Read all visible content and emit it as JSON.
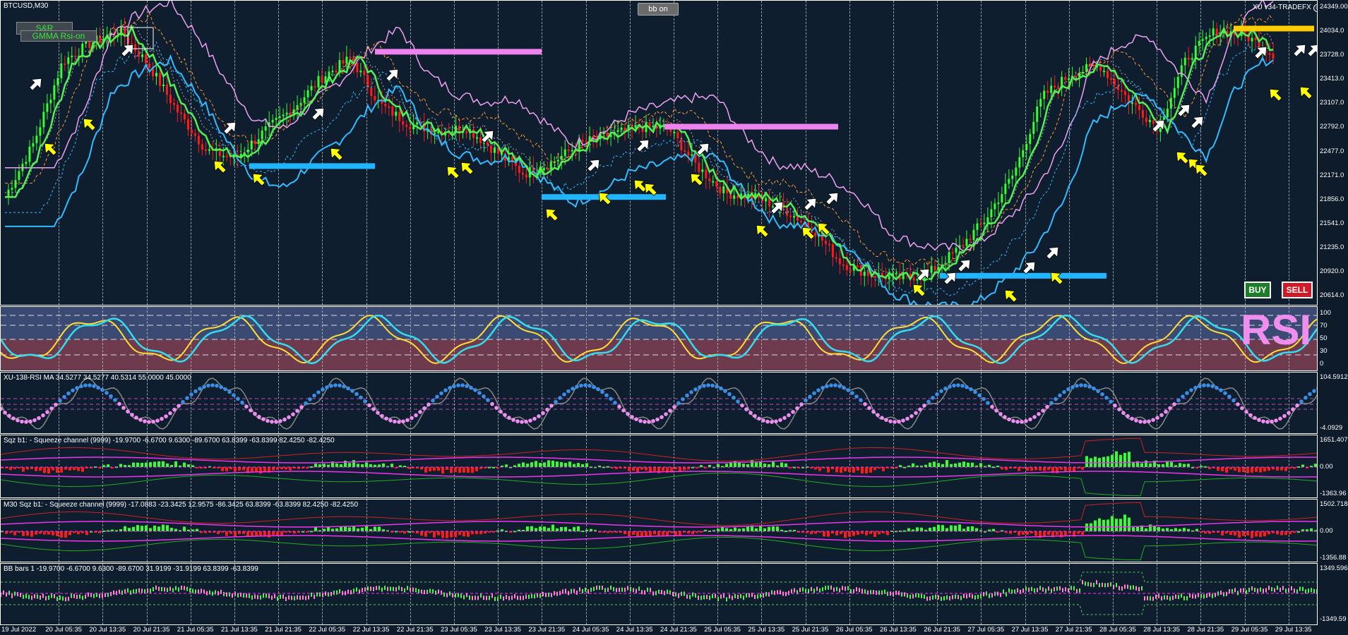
{
  "window": {
    "symbol": "BTCUSD,M30",
    "expert_label": "XU v34-TRADEFX",
    "toggle_bb_label": "bb on"
  },
  "overlay_buttons": {
    "sr_label": "S&R",
    "gmma_label": "GMMA Rsi-on",
    "buy_label": "BUY",
    "sell_label": "SELL"
  },
  "colors": {
    "background": "#0e1e2e",
    "grid": "#c8c8c8",
    "bull": "#33ff33",
    "bear": "#ff1a1a",
    "band_outer": "#f0a0f0",
    "band_inner": "#33bbff",
    "arrow_buy": "#ffff00",
    "arrow_sell": "#ffffff",
    "level_pink": "#ee82ee",
    "level_blue": "#1fb6ff",
    "level_gold": "#ffcc00"
  },
  "price_axis": {
    "ticks": [
      "24349.00",
      "24034.0",
      "23728.0",
      "23413.0",
      "23107.0",
      "22792.0",
      "22477.0",
      "22171.0",
      "21856.0",
      "21541.0",
      "21235.0",
      "20920.0",
      "20614.0"
    ]
  },
  "rsi_pane": {
    "watermark": "RSI",
    "levels": [
      "100",
      "70",
      "50",
      "30",
      "0"
    ]
  },
  "rsi_ma_pane": {
    "label": "XU-138-RSI MA 34.5277 34.5277 40.5314 55.0000 45.0000",
    "axis_top": "104.5912",
    "axis_bottom": "-4.0929"
  },
  "sqz_pane1": {
    "label": "Sqz b1: - Squeeze channel (9999) -19.9700 -6.6700 9.6300 -89.6700 63.8399 -63.8399 82.4250 -82.4250",
    "axis_top": "1651.407",
    "axis_mid": "0.00",
    "axis_bottom": "-1363.96"
  },
  "sqz_pane2": {
    "label": "M30 Sqz b1: - Squeeze channel (9999) -17.0883 -23.3425 12.9575 -86.3425 63.8399 -63.8399 82.4250 -82.4250",
    "axis_top": "1502.718",
    "axis_mid": "0.00",
    "axis_bottom": "-1356.88"
  },
  "bb_pane": {
    "label": "BB bars 1 -19.9700 -6.6700 9.6300 -89.6700 31.9199 -31.9199 63.8399 -63.8399",
    "axis_top": "1349.596",
    "axis_bottom": "-1349.59"
  },
  "time_axis": {
    "labels": [
      "19 Jul 2022",
      "20 Jul 05:35",
      "20 Jul 13:35",
      "20 Jul 21:35",
      "21 Jul 05:35",
      "21 Jul 13:35",
      "21 Jul 21:35",
      "22 Jul 05:35",
      "22 Jul 13:35",
      "22 Jul 21:35",
      "23 Jul 05:35",
      "23 Jul 13:35",
      "23 Jul 21:35",
      "24 Jul 05:35",
      "24 Jul 13:35",
      "24 Jul 21:35",
      "25 Jul 05:35",
      "25 Jul 13:35",
      "25 Jul 21:35",
      "26 Jul 05:35",
      "26 Jul 13:35",
      "26 Jul 21:35",
      "27 Jul 05:35",
      "27 Jul 13:35",
      "27 Jul 21:35",
      "28 Jul 05:35",
      "28 Jul 13:35",
      "28 Jul 21:35",
      "29 Jul 05:35",
      "29 Jul 13:35"
    ]
  },
  "chart_data": {
    "type": "line",
    "series": [
      {
        "values": [
          21900,
          22600,
          23650,
          23900,
          24050,
          23600,
          23000,
          22500,
          22400,
          22750,
          23050,
          23450,
          23700,
          23100,
          22850,
          22750,
          22800,
          22500,
          22200,
          22350,
          22600,
          22700,
          22800,
          22800,
          22300,
          21950,
          21900,
          21750,
          21500,
          21050,
          20900,
          20850,
          20900,
          21200,
          21600,
          22200,
          23200,
          23500,
          23600,
          23150,
          22800,
          23700,
          24050,
          24000,
          23750
        ]
      }
    ],
    "ylim": [
      20614,
      24349
    ]
  }
}
